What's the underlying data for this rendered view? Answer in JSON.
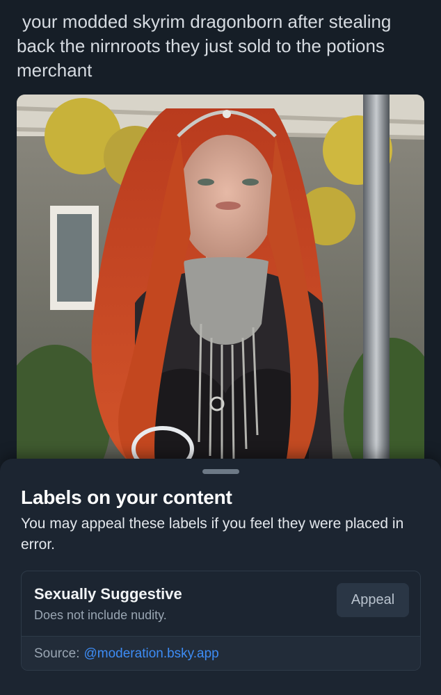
{
  "post": {
    "text": "your modded skyrim dragonborn after stealing back the nirnroots they just sold to the potions merchant"
  },
  "sheet": {
    "title": "Labels on your content",
    "description": "You may appeal these labels if you feel they were placed in error."
  },
  "label": {
    "name": "Sexually Suggestive",
    "description": "Does not include nudity.",
    "appeal_label": "Appeal",
    "source_prefix": "Source:",
    "source_handle": "@moderation.bsky.app"
  },
  "colors": {
    "background": "#161e27",
    "sheet": "#1c2531",
    "link": "#3d8cf5"
  }
}
